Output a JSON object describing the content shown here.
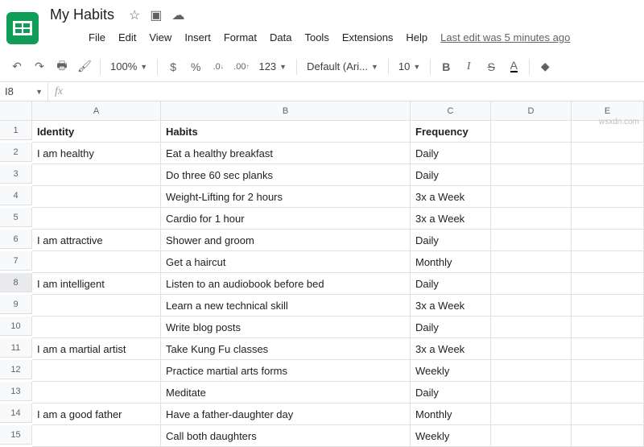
{
  "doc": {
    "title": "My Habits",
    "last_edit": "Last edit was 5 minutes ago"
  },
  "menus": [
    "File",
    "Edit",
    "View",
    "Insert",
    "Format",
    "Data",
    "Tools",
    "Extensions",
    "Help"
  ],
  "toolbar": {
    "zoom": "100%",
    "currency": "$",
    "percent": "%",
    "dec_dec": ".0",
    "inc_dec": ".00",
    "more_formats": "123",
    "font": "Default (Ari...",
    "font_size": "10",
    "bold": "B",
    "italic": "I",
    "strike": "S",
    "textcolor": "A"
  },
  "namebox": "I8",
  "fx_label": "fx",
  "columns": [
    "A",
    "B",
    "C",
    "D",
    "E"
  ],
  "headers": {
    "A": "Identity",
    "B": "Habits",
    "C": "Frequency"
  },
  "rows": [
    {
      "n": "1",
      "A": "Identity",
      "B": "Habits",
      "C": "Frequency",
      "hdr": true
    },
    {
      "n": "2",
      "A": "I am healthy",
      "B": "Eat a healthy breakfast",
      "C": "Daily"
    },
    {
      "n": "3",
      "A": "",
      "B": "Do three 60 sec planks",
      "C": "Daily"
    },
    {
      "n": "4",
      "A": "",
      "B": "Weight-Lifting for 2 hours",
      "C": "3x a Week"
    },
    {
      "n": "5",
      "A": "",
      "B": "Cardio for 1 hour",
      "C": "3x a Week"
    },
    {
      "n": "6",
      "A": "I am attractive",
      "B": "Shower and groom",
      "C": "Daily"
    },
    {
      "n": "7",
      "A": "",
      "B": "Get a haircut",
      "C": "Monthly"
    },
    {
      "n": "8",
      "A": "I am intelligent",
      "B": "Listen to an audiobook before bed",
      "C": "Daily",
      "sel": true
    },
    {
      "n": "9",
      "A": "",
      "B": "Learn a new technical skill",
      "C": "3x a Week"
    },
    {
      "n": "10",
      "A": "",
      "B": "Write blog posts",
      "C": "Daily"
    },
    {
      "n": "11",
      "A": "I am a martial artist",
      "B": "Take Kung Fu classes",
      "C": "3x a Week"
    },
    {
      "n": "12",
      "A": "",
      "B": "Practice martial arts forms",
      "C": "Weekly"
    },
    {
      "n": "13",
      "A": "",
      "B": "Meditate",
      "C": "Daily"
    },
    {
      "n": "14",
      "A": "I am a good father",
      "B": "Have a father-daughter day",
      "C": "Monthly"
    },
    {
      "n": "15",
      "A": "",
      "B": "Call both daughters",
      "C": "Weekly"
    }
  ],
  "watermark": "wsxdn.com"
}
